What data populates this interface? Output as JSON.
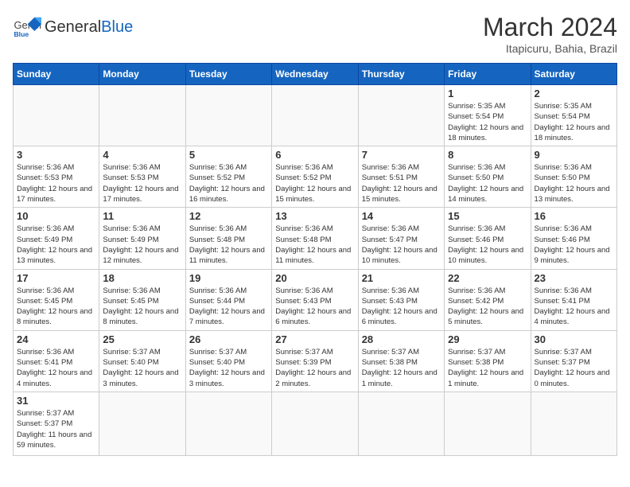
{
  "header": {
    "logo_general": "General",
    "logo_blue": "Blue",
    "title": "March 2024",
    "subtitle": "Itapicuru, Bahia, Brazil"
  },
  "days_of_week": [
    "Sunday",
    "Monday",
    "Tuesday",
    "Wednesday",
    "Thursday",
    "Friday",
    "Saturday"
  ],
  "weeks": [
    [
      {
        "day": "",
        "info": ""
      },
      {
        "day": "",
        "info": ""
      },
      {
        "day": "",
        "info": ""
      },
      {
        "day": "",
        "info": ""
      },
      {
        "day": "",
        "info": ""
      },
      {
        "day": "1",
        "info": "Sunrise: 5:35 AM\nSunset: 5:54 PM\nDaylight: 12 hours and 18 minutes."
      },
      {
        "day": "2",
        "info": "Sunrise: 5:35 AM\nSunset: 5:54 PM\nDaylight: 12 hours and 18 minutes."
      }
    ],
    [
      {
        "day": "3",
        "info": "Sunrise: 5:36 AM\nSunset: 5:53 PM\nDaylight: 12 hours and 17 minutes."
      },
      {
        "day": "4",
        "info": "Sunrise: 5:36 AM\nSunset: 5:53 PM\nDaylight: 12 hours and 17 minutes."
      },
      {
        "day": "5",
        "info": "Sunrise: 5:36 AM\nSunset: 5:52 PM\nDaylight: 12 hours and 16 minutes."
      },
      {
        "day": "6",
        "info": "Sunrise: 5:36 AM\nSunset: 5:52 PM\nDaylight: 12 hours and 15 minutes."
      },
      {
        "day": "7",
        "info": "Sunrise: 5:36 AM\nSunset: 5:51 PM\nDaylight: 12 hours and 15 minutes."
      },
      {
        "day": "8",
        "info": "Sunrise: 5:36 AM\nSunset: 5:50 PM\nDaylight: 12 hours and 14 minutes."
      },
      {
        "day": "9",
        "info": "Sunrise: 5:36 AM\nSunset: 5:50 PM\nDaylight: 12 hours and 13 minutes."
      }
    ],
    [
      {
        "day": "10",
        "info": "Sunrise: 5:36 AM\nSunset: 5:49 PM\nDaylight: 12 hours and 13 minutes."
      },
      {
        "day": "11",
        "info": "Sunrise: 5:36 AM\nSunset: 5:49 PM\nDaylight: 12 hours and 12 minutes."
      },
      {
        "day": "12",
        "info": "Sunrise: 5:36 AM\nSunset: 5:48 PM\nDaylight: 12 hours and 11 minutes."
      },
      {
        "day": "13",
        "info": "Sunrise: 5:36 AM\nSunset: 5:48 PM\nDaylight: 12 hours and 11 minutes."
      },
      {
        "day": "14",
        "info": "Sunrise: 5:36 AM\nSunset: 5:47 PM\nDaylight: 12 hours and 10 minutes."
      },
      {
        "day": "15",
        "info": "Sunrise: 5:36 AM\nSunset: 5:46 PM\nDaylight: 12 hours and 10 minutes."
      },
      {
        "day": "16",
        "info": "Sunrise: 5:36 AM\nSunset: 5:46 PM\nDaylight: 12 hours and 9 minutes."
      }
    ],
    [
      {
        "day": "17",
        "info": "Sunrise: 5:36 AM\nSunset: 5:45 PM\nDaylight: 12 hours and 8 minutes."
      },
      {
        "day": "18",
        "info": "Sunrise: 5:36 AM\nSunset: 5:45 PM\nDaylight: 12 hours and 8 minutes."
      },
      {
        "day": "19",
        "info": "Sunrise: 5:36 AM\nSunset: 5:44 PM\nDaylight: 12 hours and 7 minutes."
      },
      {
        "day": "20",
        "info": "Sunrise: 5:36 AM\nSunset: 5:43 PM\nDaylight: 12 hours and 6 minutes."
      },
      {
        "day": "21",
        "info": "Sunrise: 5:36 AM\nSunset: 5:43 PM\nDaylight: 12 hours and 6 minutes."
      },
      {
        "day": "22",
        "info": "Sunrise: 5:36 AM\nSunset: 5:42 PM\nDaylight: 12 hours and 5 minutes."
      },
      {
        "day": "23",
        "info": "Sunrise: 5:36 AM\nSunset: 5:41 PM\nDaylight: 12 hours and 4 minutes."
      }
    ],
    [
      {
        "day": "24",
        "info": "Sunrise: 5:36 AM\nSunset: 5:41 PM\nDaylight: 12 hours and 4 minutes."
      },
      {
        "day": "25",
        "info": "Sunrise: 5:37 AM\nSunset: 5:40 PM\nDaylight: 12 hours and 3 minutes."
      },
      {
        "day": "26",
        "info": "Sunrise: 5:37 AM\nSunset: 5:40 PM\nDaylight: 12 hours and 3 minutes."
      },
      {
        "day": "27",
        "info": "Sunrise: 5:37 AM\nSunset: 5:39 PM\nDaylight: 12 hours and 2 minutes."
      },
      {
        "day": "28",
        "info": "Sunrise: 5:37 AM\nSunset: 5:38 PM\nDaylight: 12 hours and 1 minute."
      },
      {
        "day": "29",
        "info": "Sunrise: 5:37 AM\nSunset: 5:38 PM\nDaylight: 12 hours and 1 minute."
      },
      {
        "day": "30",
        "info": "Sunrise: 5:37 AM\nSunset: 5:37 PM\nDaylight: 12 hours and 0 minutes."
      }
    ],
    [
      {
        "day": "31",
        "info": "Sunrise: 5:37 AM\nSunset: 5:37 PM\nDaylight: 11 hours and 59 minutes."
      },
      {
        "day": "",
        "info": ""
      },
      {
        "day": "",
        "info": ""
      },
      {
        "day": "",
        "info": ""
      },
      {
        "day": "",
        "info": ""
      },
      {
        "day": "",
        "info": ""
      },
      {
        "day": "",
        "info": ""
      }
    ]
  ]
}
